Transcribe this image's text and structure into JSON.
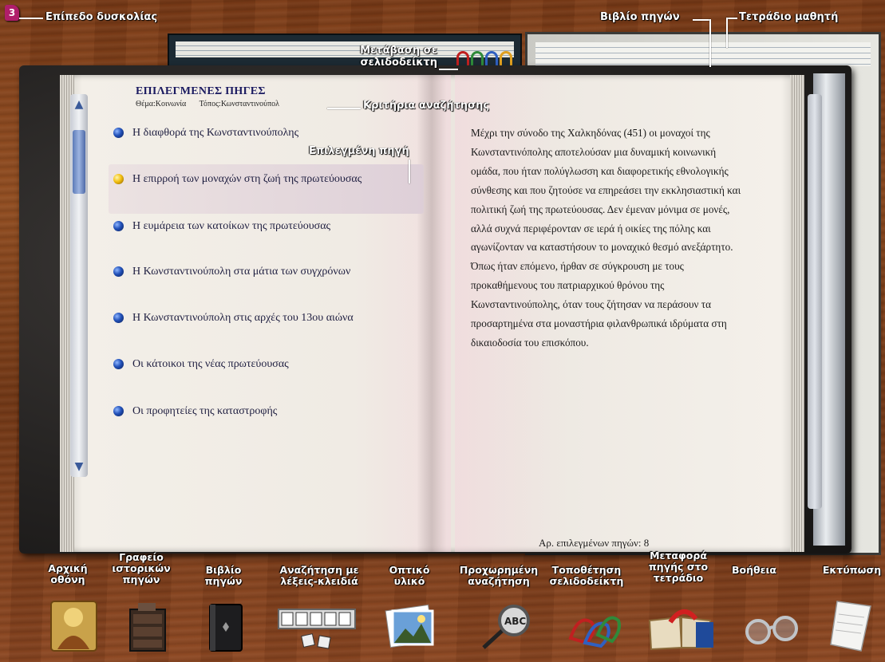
{
  "header": {
    "level_badge": "3",
    "difficulty_label": "Επίπεδο δυσκολίας",
    "source_book_label": "Βιβλίο πηγών",
    "student_notebook_label": "Τετράδιο μαθητή",
    "go_to_bookmark_label_1": "Μετάβαση σε",
    "go_to_bookmark_label_2": "σελιδοδείκτη",
    "search_criteria_callout": "Κριτήρια αναζήτησης",
    "selected_source_callout": "Επιλεγμένη πηγή"
  },
  "left_page": {
    "heading": "ΕΠΙΛΕΓΜΕΝΕΣ ΠΗΓΕΣ",
    "theme": "Θέμα:Κοινωνία",
    "place": "Τόπος:Κωνσταντινούπολ",
    "sources": [
      {
        "label": "Η διαφθορά της Κωνσταντινούπολης"
      },
      {
        "label": "Η επιρροή των μοναχών στη ζωή της πρωτεύουσας"
      },
      {
        "label": "Η ευμάρεια των κατοίκων της πρωτεύουσας"
      },
      {
        "label": "Η Κωνσταντινούπολη στα μάτια των συγχρόνων"
      },
      {
        "label": "Η Κωνσταντινούπολη στις αρχές του 13ου αιώνα"
      },
      {
        "label": "Οι κάτοικοι της νέας πρωτεύουσας"
      },
      {
        "label": "Οι προφητείες της καταστροφής"
      }
    ],
    "selected_index": 1
  },
  "right_page": {
    "text": "Μέχρι την σύνοδο της Χαλκηδόνας (451) οι μοναχοί της Κωνσταντινόπολης αποτελούσαν μια δυναμική κοινωνική ομάδα, που ήταν πολύγλωσση και διαφορετικής εθνολογικής σύνθεσης και που ζητούσε να επηρεάσει την εκκλησιαστική και πολιτική ζωή της πρωτεύουσας.  Δεν έμεναν μόνιμα σε μονές, αλλά συχνά περιφέρονταν σε ιερά ή οικίες της πόλης και αγωνίζονταν να καταστήσουν το μοναχικό θεσμό ανεξάρτητο. Όπως ήταν επόμενο, ήρθαν σε σύγκρουση με τους προκαθήμενους του πατριαρχικού θρόνου της Κωνσταντινούπολης, όταν τους ζήτησαν να περάσουν τα προσαρτημένα στα μοναστήρια φιλανθρωπικά ιδρύματα στη δικαιοδοσία του επισκόπου.",
    "selected_count": "Αρ. επιλεγμένων πηγών: 8"
  },
  "toolbar": {
    "home": "Αρχική\nοθόνη",
    "archive": "Γραφείο\nιστορικών\nπηγών",
    "source_book": "Βιβλίο\nπηγών",
    "keyword_search": "Αναζήτηση με\nλέξεις-κλειδιά",
    "visual": "Οπτικό\nυλικό",
    "advanced_search": "Προχωρημένη\nαναζήτηση",
    "place_bookmark": "Τοποθέτηση\nσελιδοδείκτη",
    "move_to_notebook": "Μεταφορά\nπηγής στο\nτετράδιο",
    "help": "Βοήθεια",
    "print": "Εκτύπωση",
    "abc": "ABC"
  }
}
